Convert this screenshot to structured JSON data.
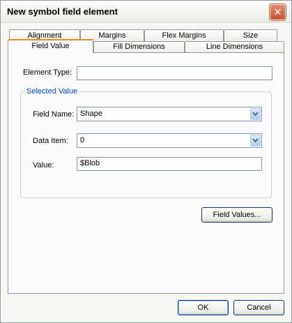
{
  "window": {
    "title": "New symbol field element"
  },
  "tabs": {
    "row1": [
      {
        "label": "Alignment"
      },
      {
        "label": "Margins"
      },
      {
        "label": "Flex Margins"
      },
      {
        "label": "Size"
      }
    ],
    "row2": [
      {
        "label": "Field Value",
        "active": true
      },
      {
        "label": "Fill Dimensions"
      },
      {
        "label": "Line Dimensions"
      }
    ]
  },
  "form": {
    "element_type_label": "Element Type:",
    "element_type_value": "",
    "group_title": "Selected Value",
    "field_name_label": "Field Name:",
    "field_name_value": "Shape",
    "data_item_label": "Data Item:",
    "data_item_value": "0",
    "value_label": "Value:",
    "value_value": "$Blob",
    "field_values_button": "Field Values..."
  },
  "buttons": {
    "ok": "OK",
    "cancel": "Cancel"
  },
  "icons": {
    "close": "close-icon",
    "combo_arrow": "chevron-down-icon"
  },
  "colors": {
    "accent": "#e68b2c",
    "group_title": "#0046d5",
    "close": "#c9502f"
  }
}
